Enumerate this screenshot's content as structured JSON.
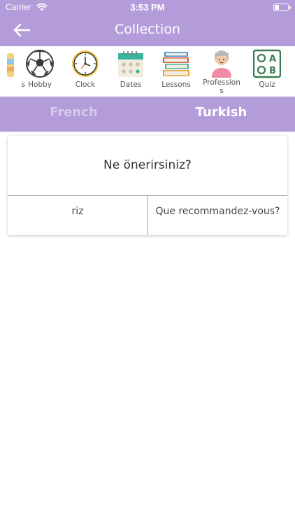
{
  "status_bar": {
    "carrier": "Carrier",
    "time": "3:53 PM",
    "battery_level": 0.35
  },
  "nav": {
    "title": "Collection",
    "back_icon": "arrow-left-icon"
  },
  "categories": [
    {
      "label": "s",
      "icon": "partial-icon"
    },
    {
      "label": "Hobby",
      "icon": "soccer-ball-icon"
    },
    {
      "label": "Clock",
      "icon": "clock-icon"
    },
    {
      "label": "Dates",
      "icon": "calendar-icon"
    },
    {
      "label": "Lessons",
      "icon": "books-icon"
    },
    {
      "label": "Profession",
      "label_line2": "s",
      "icon": "person-icon"
    },
    {
      "label": "Quiz",
      "icon": "quiz-icon"
    }
  ],
  "languages": {
    "left": "French",
    "right": "Turkish",
    "selected": "Turkish"
  },
  "card": {
    "question": "Ne önerirsiniz?",
    "answers": [
      "riz",
      "Que recommandez-vous?"
    ]
  },
  "colors": {
    "header": "#b49bd9",
    "tab_inactive": "#d7c9ec",
    "tab_active": "#ffffff"
  }
}
